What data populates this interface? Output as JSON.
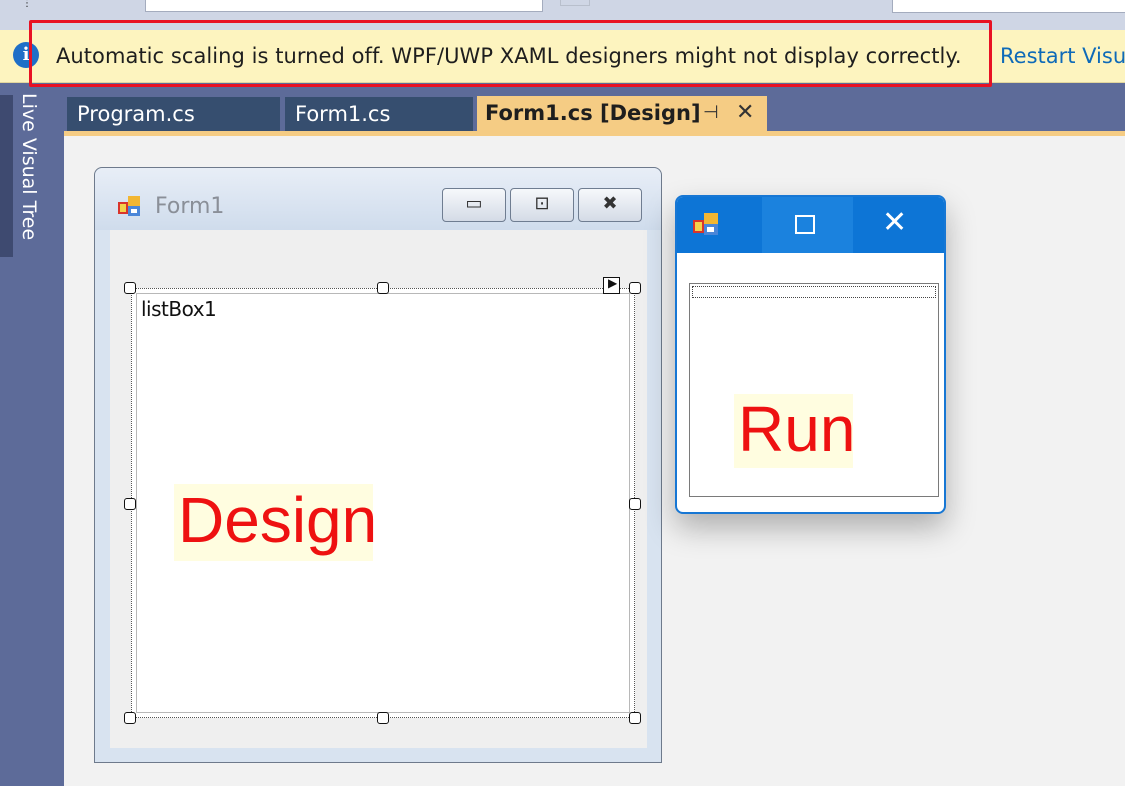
{
  "infobar": {
    "message": "Automatic scaling is turned off. WPF/UWP XAML designers might not display correctly.",
    "link_text": "Restart Visua",
    "highlight_color": "#e81123"
  },
  "dock": {
    "live_visual_tree": "Live Visual Tree"
  },
  "tabs": [
    {
      "label": "Program.cs",
      "active": false
    },
    {
      "label": "Form1.cs",
      "active": false
    },
    {
      "label": "Form1.cs [Design]",
      "active": true
    }
  ],
  "tab_icons": {
    "pin": "pin-icon",
    "close": "close-icon"
  },
  "design_form": {
    "title": "Form1",
    "listbox_name": "listBox1",
    "overlay_label": "Design"
  },
  "run_window": {
    "overlay_label": "Run"
  },
  "colors": {
    "accent_blue": "#0d75d6",
    "tab_active": "#f5cc84",
    "tab_inactive": "#364e6f",
    "dock_bg": "#5d6b99",
    "overlay_text": "#ee1111"
  }
}
